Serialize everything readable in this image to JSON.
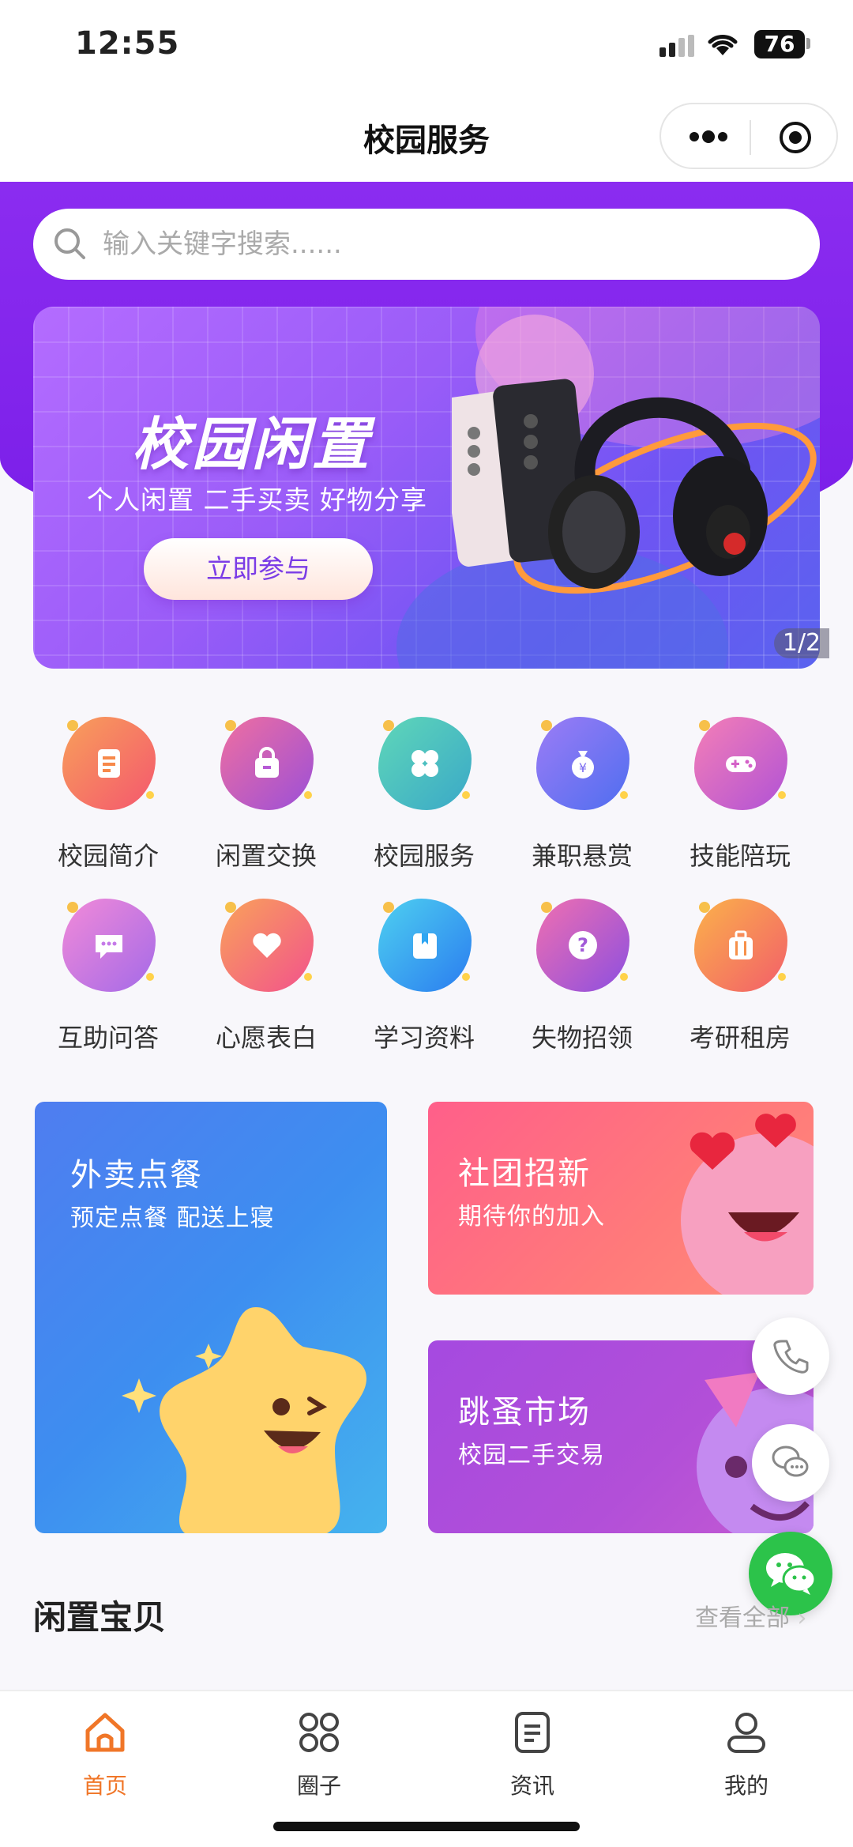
{
  "status_bar": {
    "time": "12:55",
    "battery": "76"
  },
  "nav": {
    "title": "校园服务"
  },
  "search": {
    "placeholder": "输入关键字搜索......"
  },
  "banner": {
    "title": "校园闲置",
    "subtitle": "个人闲置 二手买卖 好物分享",
    "button_label": "立即参与",
    "counter": "1/2"
  },
  "grid": {
    "items": [
      {
        "label": "校园简介",
        "icon": "document-icon",
        "color": "#f7894a"
      },
      {
        "label": "闲置交换",
        "icon": "bag-icon",
        "color": "#b65ad6"
      },
      {
        "label": "校园服务",
        "icon": "clover-icon",
        "color": "#3dcaa6"
      },
      {
        "label": "兼职悬赏",
        "icon": "money-bag-icon",
        "color": "#7a6bf0"
      },
      {
        "label": "技能陪玩",
        "icon": "gamepad-icon",
        "color": "#d462c8"
      },
      {
        "label": "互助问答",
        "icon": "chat-bubble-icon",
        "color": "#c57ae8"
      },
      {
        "label": "心愿表白",
        "icon": "heart-icon",
        "color": "#f47c5e"
      },
      {
        "label": "学习资料",
        "icon": "book-icon",
        "color": "#2fa6f2"
      },
      {
        "label": "失物招领",
        "icon": "question-icon",
        "color": "#a25ad8"
      },
      {
        "label": "考研租房",
        "icon": "suitcase-icon",
        "color": "#f6904a"
      }
    ]
  },
  "cards": {
    "takeout": {
      "title": "外卖点餐",
      "subtitle": "预定点餐 配送上寝"
    },
    "club": {
      "title": "社团招新",
      "subtitle": "期待你的加入"
    },
    "market": {
      "title": "跳蚤市场",
      "subtitle": "校园二手交易"
    }
  },
  "section": {
    "title": "闲置宝贝",
    "more": "查看全部"
  },
  "tabs": [
    {
      "label": "首页",
      "icon": "home-icon",
      "active": true
    },
    {
      "label": "圈子",
      "icon": "circles-icon",
      "active": false
    },
    {
      "label": "资讯",
      "icon": "news-icon",
      "active": false
    },
    {
      "label": "我的",
      "icon": "profile-icon",
      "active": false
    }
  ],
  "colors": {
    "accent": "#f07628",
    "brand_purple": "#8b2cf0",
    "wechat_green": "#2cc34a"
  }
}
